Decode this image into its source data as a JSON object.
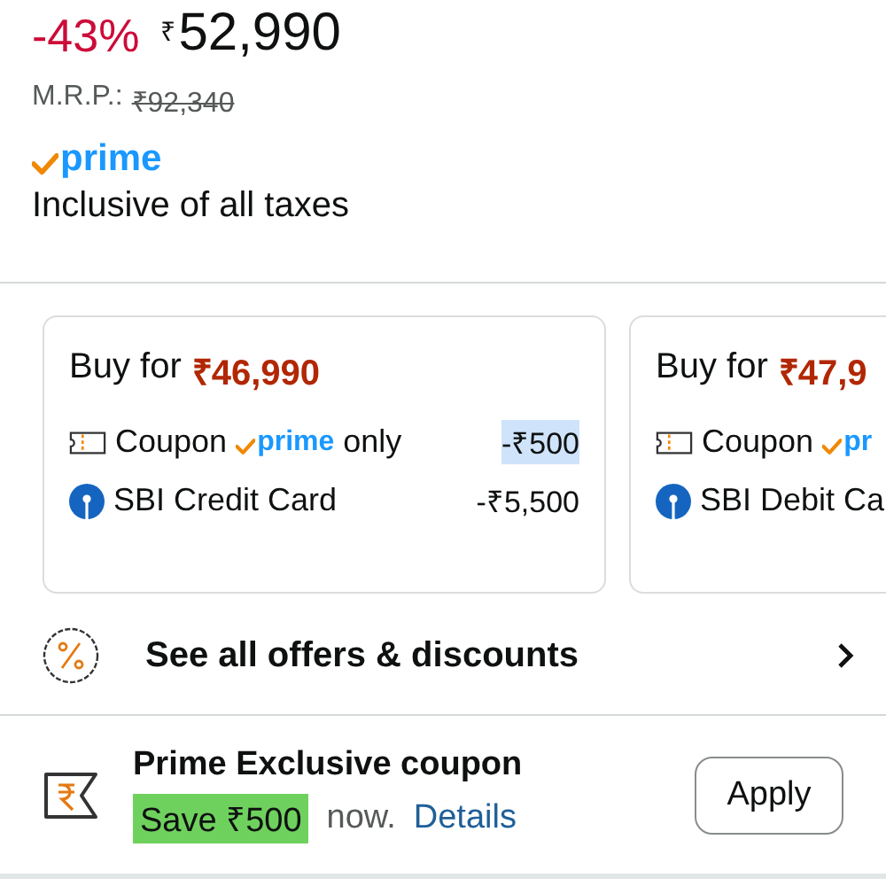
{
  "price": {
    "discount": "-43%",
    "currency": "₹",
    "amount": "52,990",
    "mrp_label": "M.R.P.:",
    "mrp": "₹92,340"
  },
  "prime_badge": "prime",
  "tax_note": "Inclusive of all taxes",
  "offers": [
    {
      "title": "Buy for",
      "price": "₹46,990",
      "rows": [
        {
          "kind": "coupon",
          "label": "Coupon",
          "badge": "prime",
          "suffix": "only",
          "amount": "-₹500",
          "highlighted": true
        },
        {
          "kind": "bank",
          "label": "SBI Credit Card",
          "amount": "-₹5,500",
          "highlighted": false
        }
      ]
    },
    {
      "title": "Buy for",
      "price": "₹47,9",
      "rows": [
        {
          "kind": "coupon",
          "label": "Coupon",
          "badge": "pr"
        },
        {
          "kind": "bank",
          "label": "SBI Debit Ca"
        }
      ]
    }
  ],
  "see_all": "See all offers & discounts",
  "coupon": {
    "title": "Prime Exclusive coupon",
    "save": "Save ₹500",
    "note": "now.",
    "link": "Details",
    "button": "Apply"
  }
}
